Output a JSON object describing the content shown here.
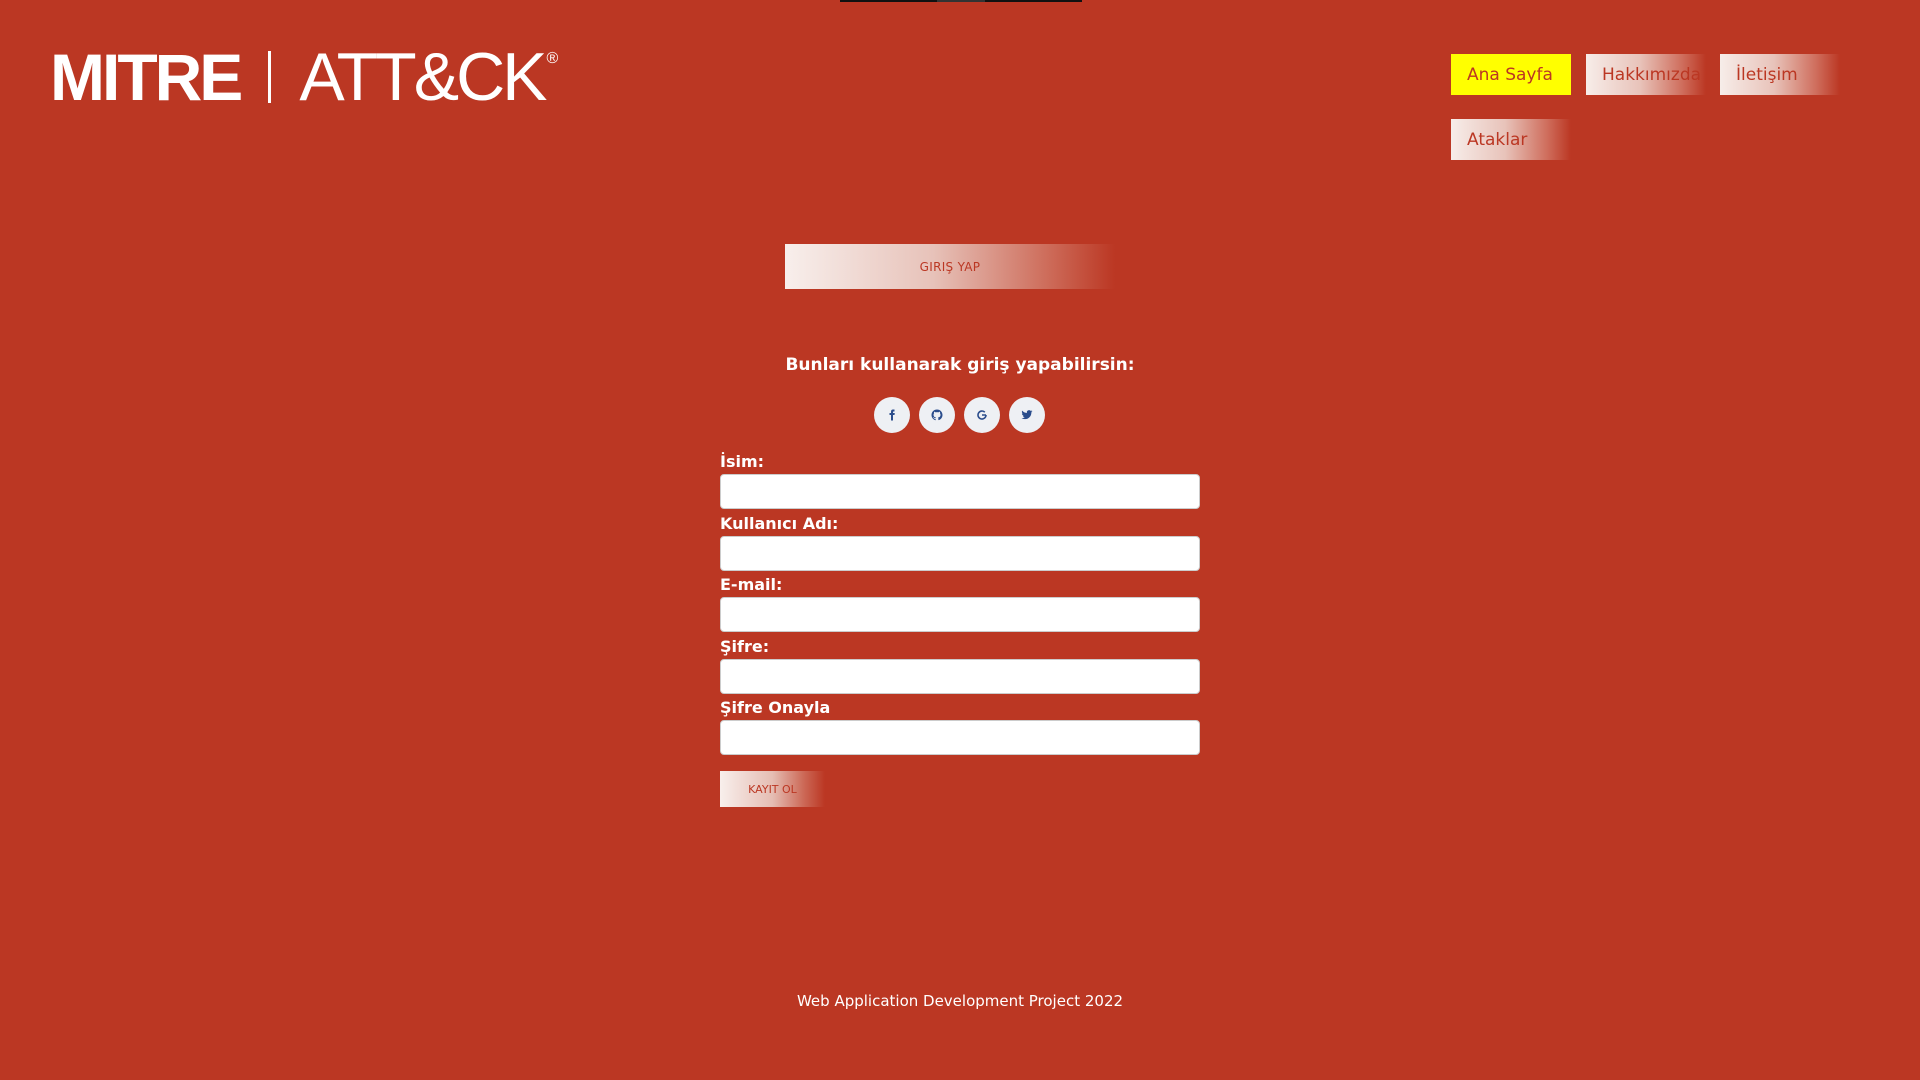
{
  "logo": {
    "mitre": "MITRE",
    "attck": "ATT&CK",
    "registered": "®"
  },
  "nav": {
    "home": "Ana Sayfa",
    "about": "Hakkımızda",
    "contact": "İletişim",
    "attacks": "Ataklar",
    "active_color": "#ffff00"
  },
  "login": {
    "label": "GIRIŞ YAP"
  },
  "social": {
    "title": "Bunları kullanarak giriş yapabilirsin:",
    "icons": [
      "facebook-icon",
      "github-icon",
      "google-icon",
      "twitter-icon"
    ]
  },
  "form": {
    "name_label": "İsim:",
    "username_label": "Kullanıcı Adı:",
    "email_label": "E-mail:",
    "password_label": "Şifre:",
    "confirm_label": "Şifre Onayla",
    "submit_label": "KAYIT OL"
  },
  "footer": {
    "text": "Web Application Development Project 2022"
  },
  "colors": {
    "background": "#bb3723",
    "accent": "#ffff00",
    "social_icon": "#2b4d8c"
  }
}
